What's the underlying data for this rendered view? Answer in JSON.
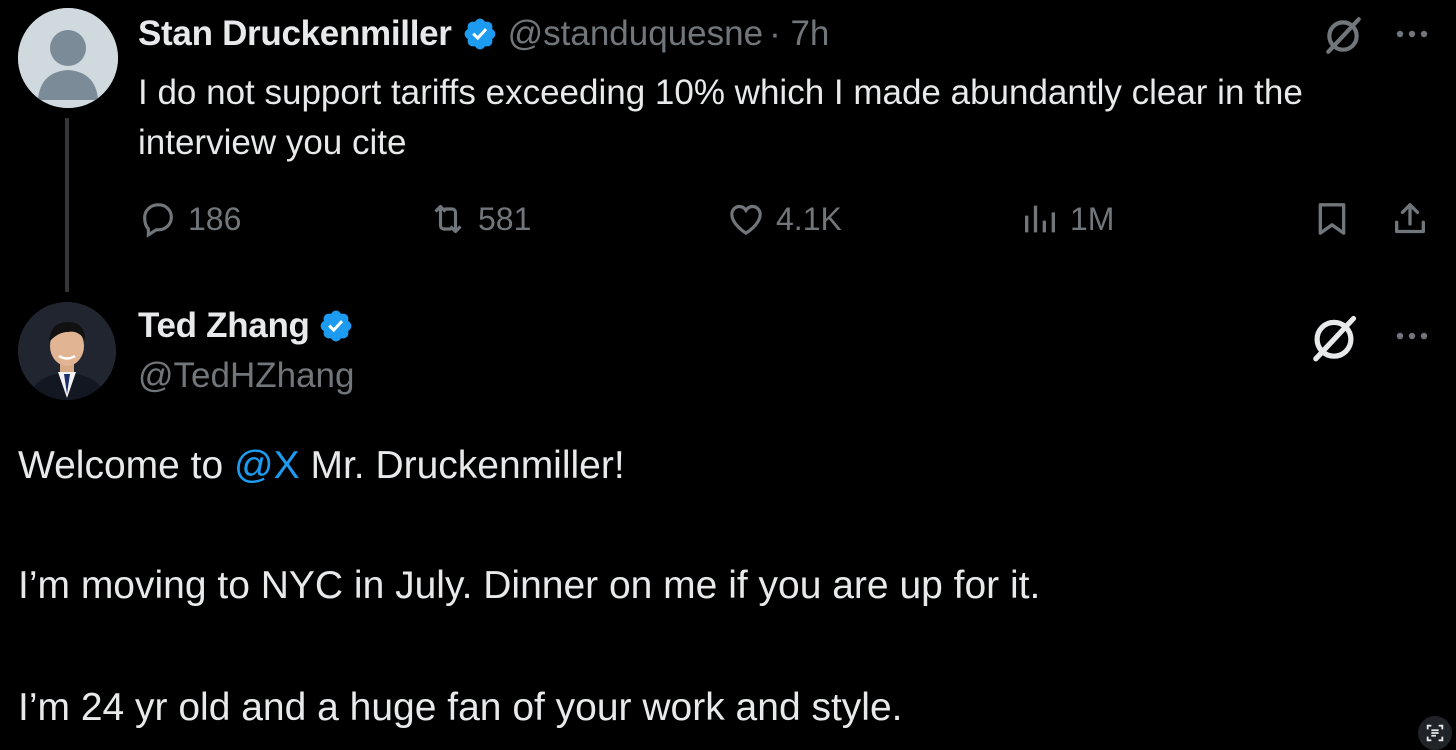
{
  "tweet1": {
    "name": "Stan Druckenmiller",
    "handle": "@standuquesne",
    "time": "· 7h",
    "text": "I do not support tariffs exceeding 10% which I made abundantly clear in the interview you cite",
    "actions": {
      "replies": "186",
      "retweets": "581",
      "likes": "4.1K",
      "views": "1M"
    }
  },
  "tweet2": {
    "name": "Ted Zhang",
    "handle": "@TedHZhang",
    "p1_before": "Welcome to ",
    "p1_mention": "@X",
    "p1_after": " Mr. Druckenmiller!",
    "p2": "I’m moving to NYC in July. Dinner on me if you are up for it.",
    "p3": "I’m 24 yr old and a huge fan of your work and style."
  },
  "colors": {
    "background": "#000000",
    "text": "#e7e9ea",
    "muted": "#71767b",
    "accent": "#1d9bf0"
  },
  "icons": [
    "verified-badge-icon",
    "grok-icon",
    "more-icon",
    "reply-icon",
    "retweet-icon",
    "like-icon",
    "views-icon",
    "bookmark-icon",
    "share-icon",
    "text-scan-icon"
  ]
}
